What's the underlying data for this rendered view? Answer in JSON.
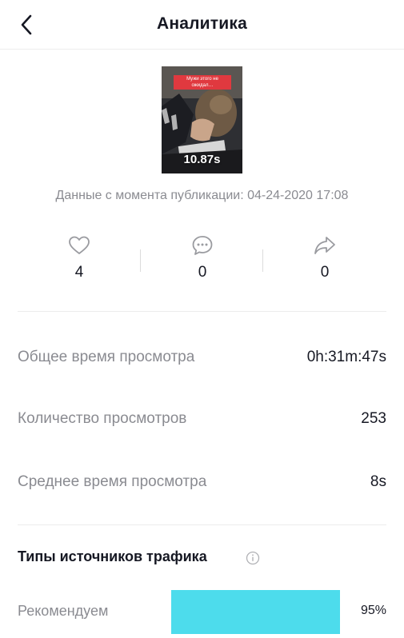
{
  "header": {
    "title": "Аналитика"
  },
  "video": {
    "caption": "Мужи этого не ожидал…",
    "duration": "10.87s"
  },
  "since_text": "Данные с момента публикации: 04-24-2020 17:08",
  "interactions": [
    {
      "icon": "heart-icon",
      "count": "4"
    },
    {
      "icon": "comment-icon",
      "count": "0"
    },
    {
      "icon": "share-icon",
      "count": "0"
    }
  ],
  "stats": [
    {
      "label": "Общее время просмотра",
      "value": "0h:31m:47s"
    },
    {
      "label": "Количество просмотров",
      "value": "253"
    },
    {
      "label": "Среднее время просмотра",
      "value": "8s"
    }
  ],
  "traffic": {
    "title": "Типы источников трафика",
    "sources": [
      {
        "label": "Рекомендуем",
        "percent": "95%",
        "share": 0.95
      }
    ]
  },
  "colors": {
    "bar": "#4ddcec",
    "caption_bg": "#e0393f",
    "muted_text": "#8a8b91",
    "primary_text": "#161823"
  }
}
